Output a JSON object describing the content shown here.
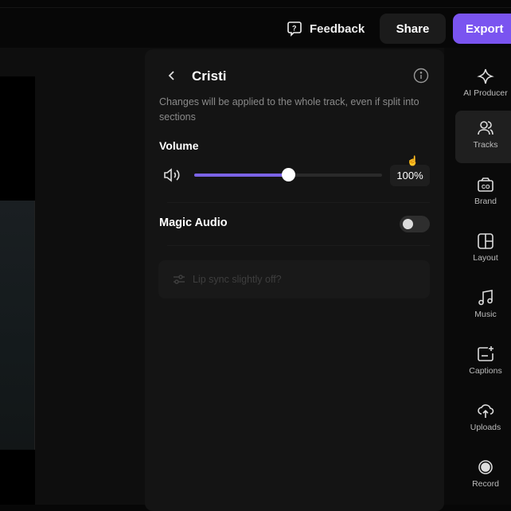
{
  "header": {
    "feedback_label": "Feedback",
    "share_label": "Share",
    "export_label": "Export",
    "accent": "#7a54f0"
  },
  "panel": {
    "title": "Cristi",
    "description": "Changes will be applied to the whole track, even if split into sections",
    "volume_label": "Volume",
    "volume_percent": 50,
    "volume_value": "100%",
    "magic_audio_label": "Magic Audio",
    "magic_audio_on": false,
    "lip_sync_label": "Lip sync slightly off?"
  },
  "sidebar": {
    "items": [
      {
        "label": "AI Producer",
        "icon": "sparkle-icon"
      },
      {
        "label": "Tracks",
        "icon": "users-icon",
        "active": true
      },
      {
        "label": "Brand",
        "icon": "brand-kit-icon"
      },
      {
        "label": "Layout",
        "icon": "layout-icon"
      },
      {
        "label": "Music",
        "icon": "music-icon"
      },
      {
        "label": "Captions",
        "icon": "captions-icon"
      },
      {
        "label": "Uploads",
        "icon": "cloud-upload-icon"
      },
      {
        "label": "Record",
        "icon": "record-icon"
      }
    ]
  }
}
